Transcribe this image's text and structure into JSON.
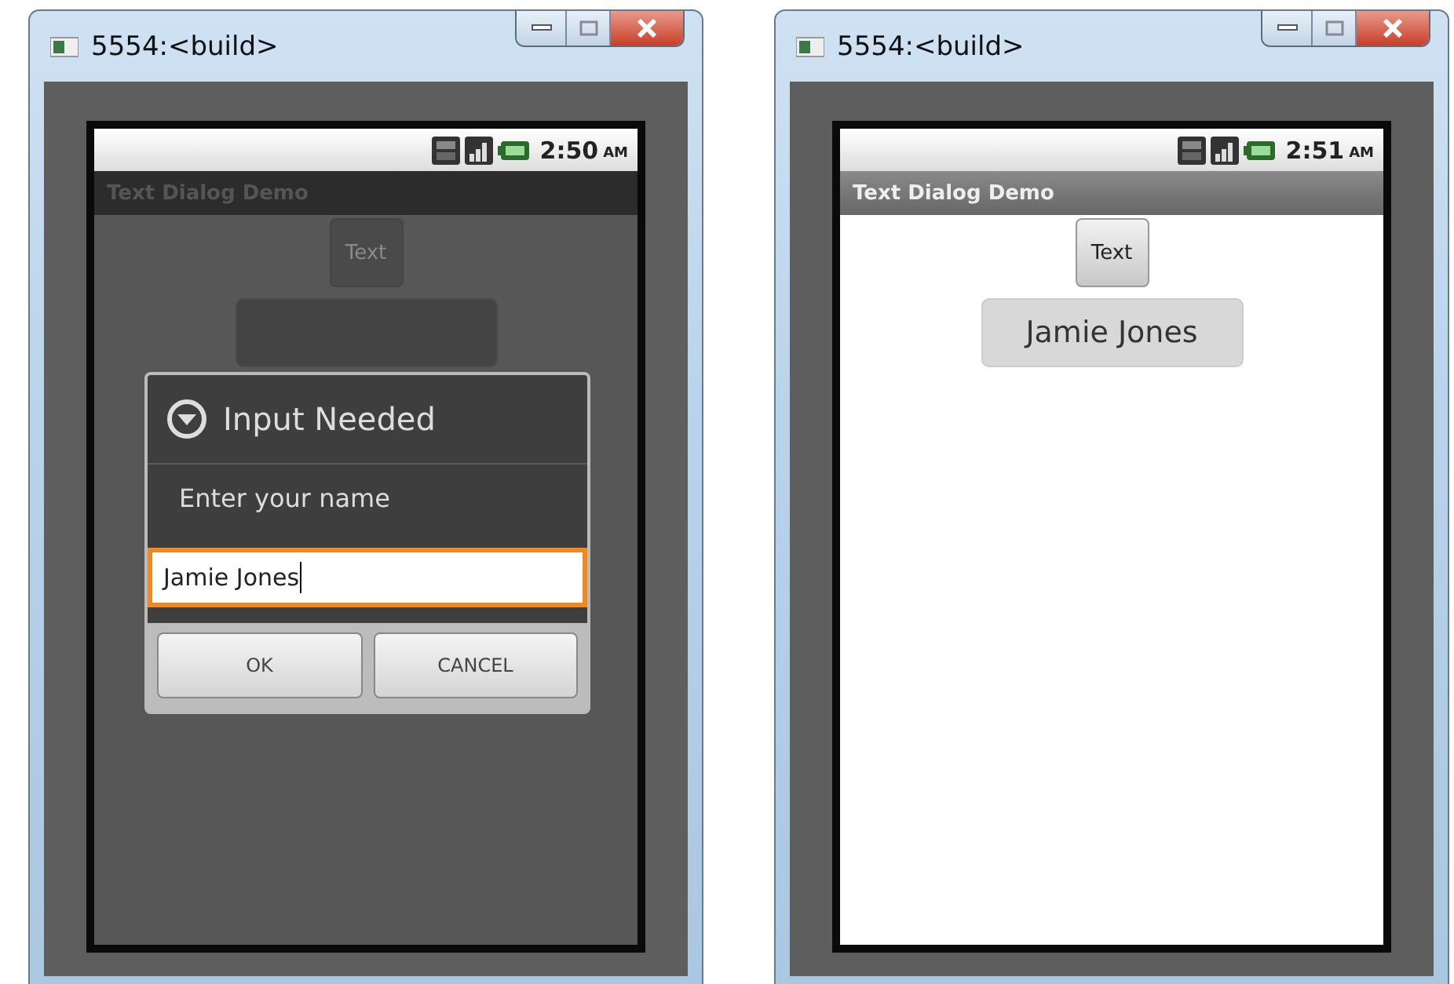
{
  "windows": [
    {
      "title": "5554:<build>",
      "status_time": "2:50",
      "status_ampm": "AM",
      "app_title": "Text Dialog Demo",
      "dimmed": true,
      "text_button": "Text",
      "dialog": {
        "title": "Input Needed",
        "message": "Enter your name",
        "value": "Jamie Jones",
        "buttons": [
          "OK",
          "CANCEL"
        ]
      }
    },
    {
      "title": "5554:<build>",
      "status_time": "2:51",
      "status_ampm": "AM",
      "app_title": "Text Dialog Demo",
      "dimmed": false,
      "text_button": "Text",
      "name_display": "Jamie Jones"
    }
  ]
}
